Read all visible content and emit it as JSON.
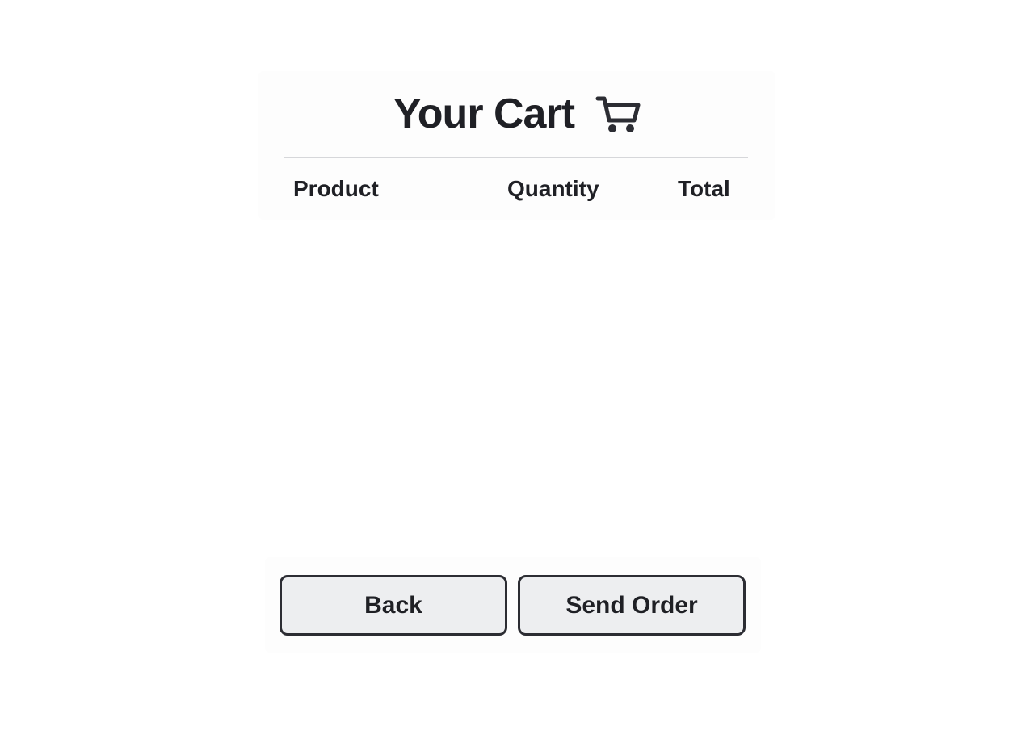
{
  "cart": {
    "title": "Your Cart",
    "icon": "shopping-cart-icon",
    "columns": {
      "product": "Product",
      "quantity": "Quantity",
      "total": "Total"
    },
    "items": []
  },
  "actions": {
    "back_label": "Back",
    "send_order_label": "Send Order"
  },
  "colors": {
    "text": "#1f2025",
    "button_bg": "#edeef0",
    "button_border": "#2c2d33",
    "divider": "#d6d7da"
  }
}
